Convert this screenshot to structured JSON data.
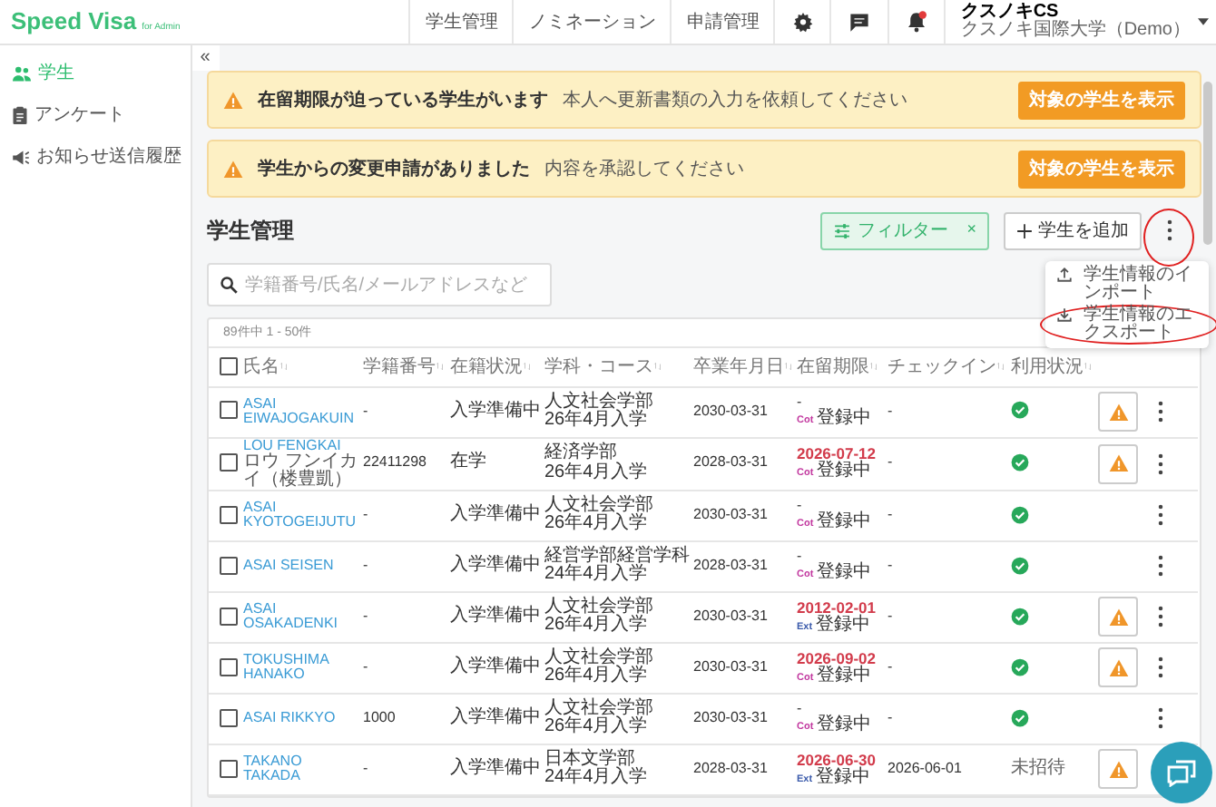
{
  "header": {
    "logo": "Speed Visa",
    "logo_suffix": "for Admin",
    "nav": [
      "学生管理",
      "ノミネーション",
      "申請管理"
    ],
    "user": {
      "name": "クスノキCS",
      "org": "クスノキ国際大学（Demo）"
    }
  },
  "sidebar": {
    "items": [
      {
        "label": "学生",
        "kind": "people",
        "selected": true
      },
      {
        "label": "アンケート",
        "kind": "clipboard",
        "selected": false
      },
      {
        "label": "お知らせ送信履歴",
        "kind": "megaphone",
        "selected": false
      }
    ]
  },
  "collapse": "«",
  "alerts": [
    {
      "title": "在留期限が迫っている学生がいます",
      "message": "本人へ更新書類の入力を依頼してください",
      "button": "対象の学生を表示"
    },
    {
      "title": "学生からの変更申請がありました",
      "message": "内容を承認してください",
      "button": "対象の学生を表示"
    }
  ],
  "page_title": "学生管理",
  "toolbar": {
    "filter": "フィルター",
    "filter_clear": "×",
    "add": "学生を追加",
    "more_highlighted": true
  },
  "more_menu": [
    {
      "label": "学生情報のインポート",
      "kind": "upload",
      "highlighted": false
    },
    {
      "label": "学生情報のエクスポート",
      "kind": "download",
      "highlighted": true
    }
  ],
  "search": {
    "placeholder": "学籍番号/氏名/メールアドレスなど"
  },
  "table": {
    "count": "89件中 1 - 50件",
    "select_all_checked": false,
    "columns": [
      "氏名",
      "学籍番号",
      "在籍状況",
      "学科・コース",
      "卒業年月日",
      "在留期限",
      "チェックイン",
      "利用状況"
    ],
    "rows": [
      {
        "checked": false,
        "name": "ASAI EIWAJOGAKUIN",
        "kana": null,
        "number": "-",
        "status": "入学準備中",
        "dept": "人文社会学部",
        "intake": "26年4月入学",
        "graduation": "2030-03-31",
        "deadline": {
          "text": "-",
          "alert": false
        },
        "tag": {
          "label": "Cot",
          "color": "#c2389f"
        },
        "registration": "登録中",
        "checkin": "-",
        "usage": {
          "kind": "ok"
        },
        "warning": true,
        "more": true
      },
      {
        "checked": false,
        "name": "LOU FENGKAI",
        "kana": "ロウ フンイカイ（楼豊凱）",
        "number": "22411298",
        "status": "在学",
        "dept": "経済学部",
        "intake": "26年4月入学",
        "graduation": "2028-03-31",
        "deadline": {
          "text": "2026-07-12",
          "alert": true
        },
        "tag": {
          "label": "Cot",
          "color": "#c2389f"
        },
        "registration": "登録中",
        "checkin": "-",
        "usage": {
          "kind": "ok"
        },
        "warning": true,
        "more": true
      },
      {
        "checked": false,
        "name": "ASAI KYOTOGEIJUTU",
        "kana": null,
        "number": "-",
        "status": "入学準備中",
        "dept": "人文社会学部",
        "intake": "26年4月入学",
        "graduation": "2030-03-31",
        "deadline": {
          "text": "-",
          "alert": false
        },
        "tag": {
          "label": "Cot",
          "color": "#c2389f"
        },
        "registration": "登録中",
        "checkin": "-",
        "usage": {
          "kind": "ok"
        },
        "warning": false,
        "more": true
      },
      {
        "checked": false,
        "name": "ASAI SEISEN",
        "kana": null,
        "number": "-",
        "status": "入学準備中",
        "dept": "経営学部経営学科",
        "intake": "24年4月入学",
        "graduation": "2028-03-31",
        "deadline": {
          "text": "-",
          "alert": false
        },
        "tag": {
          "label": "Cot",
          "color": "#c2389f"
        },
        "registration": "登録中",
        "checkin": "-",
        "usage": {
          "kind": "ok"
        },
        "warning": false,
        "more": true
      },
      {
        "checked": false,
        "name": "ASAI OSAKADENKI",
        "kana": null,
        "number": "-",
        "status": "入学準備中",
        "dept": "人文社会学部",
        "intake": "26年4月入学",
        "graduation": "2030-03-31",
        "deadline": {
          "text": "2012-02-01",
          "alert": true
        },
        "tag": {
          "label": "Ext",
          "color": "#3b5bab"
        },
        "registration": "登録中",
        "checkin": "-",
        "usage": {
          "kind": "ok"
        },
        "warning": true,
        "more": true
      },
      {
        "checked": false,
        "name": "TOKUSHIMA HANAKO",
        "kana": null,
        "number": "-",
        "status": "入学準備中",
        "dept": "人文社会学部",
        "intake": "26年4月入学",
        "graduation": "2030-03-31",
        "deadline": {
          "text": "2026-09-02",
          "alert": true
        },
        "tag": {
          "label": "Cot",
          "color": "#c2389f"
        },
        "registration": "登録中",
        "checkin": "-",
        "usage": {
          "kind": "ok"
        },
        "warning": true,
        "more": true
      },
      {
        "checked": false,
        "name": "ASAI RIKKYO",
        "kana": null,
        "number": "1000",
        "status": "入学準備中",
        "dept": "人文社会学部",
        "intake": "26年4月入学",
        "graduation": "2030-03-31",
        "deadline": {
          "text": "-",
          "alert": false
        },
        "tag": {
          "label": "Cot",
          "color": "#c2389f"
        },
        "registration": "登録中",
        "checkin": "-",
        "usage": {
          "kind": "ok"
        },
        "warning": false,
        "more": true
      },
      {
        "checked": false,
        "name": "TAKANO TAKADA",
        "kana": null,
        "number": "-",
        "status": "入学準備中",
        "dept": "日本文学部",
        "intake": "24年4月入学",
        "graduation": "2028-03-31",
        "deadline": {
          "text": "2026-06-30",
          "alert": true
        },
        "tag": {
          "label": "Ext",
          "color": "#3b5bab"
        },
        "registration": "登録中",
        "checkin": "2026-06-01",
        "usage": {
          "kind": "text",
          "text": "未招待"
        },
        "warning": true,
        "more": false
      }
    ]
  }
}
